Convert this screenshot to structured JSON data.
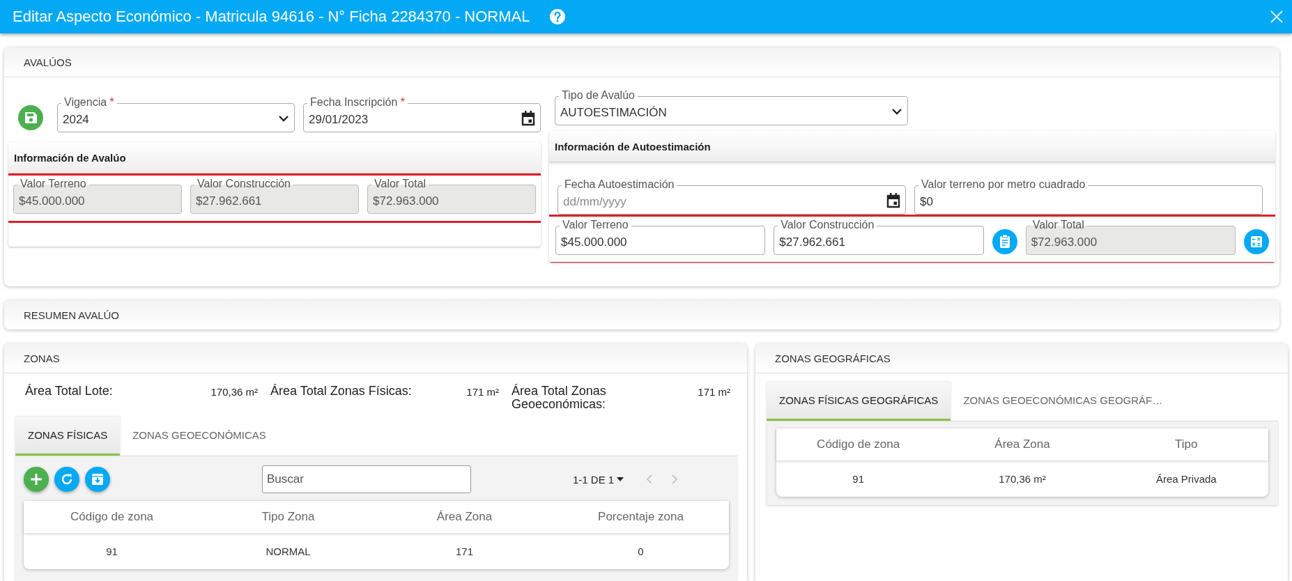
{
  "window": {
    "title": "Editar Aspecto Económico - Matricula 94616 - N° Ficha 2284370 - NORMAL"
  },
  "avaluos": {
    "title": "AVALÚOS",
    "fields": [
      {
        "kind": "select",
        "label": "Vigencia",
        "required_mark": "*",
        "value": "2024",
        "disabled": false
      },
      {
        "kind": "date",
        "label": "Fecha Inscripción",
        "required_mark": "*",
        "value": "29/01/2023",
        "disabled": false
      }
    ],
    "tipo": {
      "kind": "select",
      "label": "Tipo de Avalúo",
      "value": "AUTOESTIMACIÓN",
      "disabled": false
    },
    "info_avaluo": {
      "title": "Información de Avalúo",
      "highlighted": true,
      "fields": [
        {
          "kind": "text",
          "label": "Valor Terreno",
          "value": "$45.000.000",
          "disabled": true
        },
        {
          "kind": "text",
          "label": "Valor Construcción",
          "value": "$27.962.661",
          "disabled": true
        },
        {
          "kind": "text",
          "label": "Valor Total",
          "value": "$72.963.000",
          "disabled": true
        }
      ]
    },
    "info_autoestimacion": {
      "title": "Información de Autoestimación",
      "fields": [
        {
          "kind": "date",
          "label": "Fecha Autoestimación",
          "placeholder": "dd/mm/yyyy",
          "disabled": false
        },
        {
          "kind": "text",
          "label": "Valor terreno por metro cuadrado",
          "value": "$0",
          "disabled": false
        }
      ],
      "valores": {
        "highlighted": true,
        "fields": [
          {
            "kind": "text",
            "label": "Valor Terreno",
            "value": "$45.000.000",
            "disabled": false
          },
          {
            "kind": "text",
            "label": "Valor Construcción",
            "value": "$27.962.661",
            "disabled": false,
            "action": {
              "kind": "clipboard"
            }
          },
          {
            "kind": "text",
            "label": "Valor Total",
            "value": "$72.963.000",
            "disabled": true,
            "action": {
              "kind": "calculator"
            }
          }
        ]
      }
    }
  },
  "resumen": {
    "title": "RESUMEN AVALÚO"
  },
  "zonas": {
    "title": "ZONAS",
    "totals": [
      {
        "label": "Área Total Lote:",
        "value": "170,36 m²"
      },
      {
        "label": "Área Total Zonas Físicas:",
        "value": "171 m²"
      },
      {
        "label": "Área Total Zonas Geoeconómicas:",
        "value": "171 m²"
      }
    ],
    "tabs": [
      {
        "label": "ZONAS FÍSICAS",
        "selected": true
      },
      {
        "label": "ZONAS GEOECONÓMICAS",
        "selected": false
      }
    ],
    "search": {
      "placeholder": "Buscar"
    },
    "pagination": "1-1 DE 1",
    "table": {
      "columns": [
        "Código de zona",
        "Tipo Zona",
        "Área Zona",
        "Porcentaje zona"
      ],
      "rows": [
        [
          "91",
          "NORMAL",
          "171",
          "0"
        ]
      ]
    }
  },
  "zonas_geograficas": {
    "title": "ZONAS GEOGRÁFICAS",
    "tabs": [
      {
        "label": "ZONAS FÍSICAS GEOGRÁFICAS",
        "selected": true
      },
      {
        "label": "ZONAS GEOECONÓMICAS GEOGRÁF…",
        "selected": false
      }
    ],
    "table": {
      "columns": [
        "Código de zona",
        "Área Zona",
        "Tipo"
      ],
      "rows": [
        [
          "91",
          "170,36 m²",
          "Área Privada"
        ]
      ]
    }
  }
}
